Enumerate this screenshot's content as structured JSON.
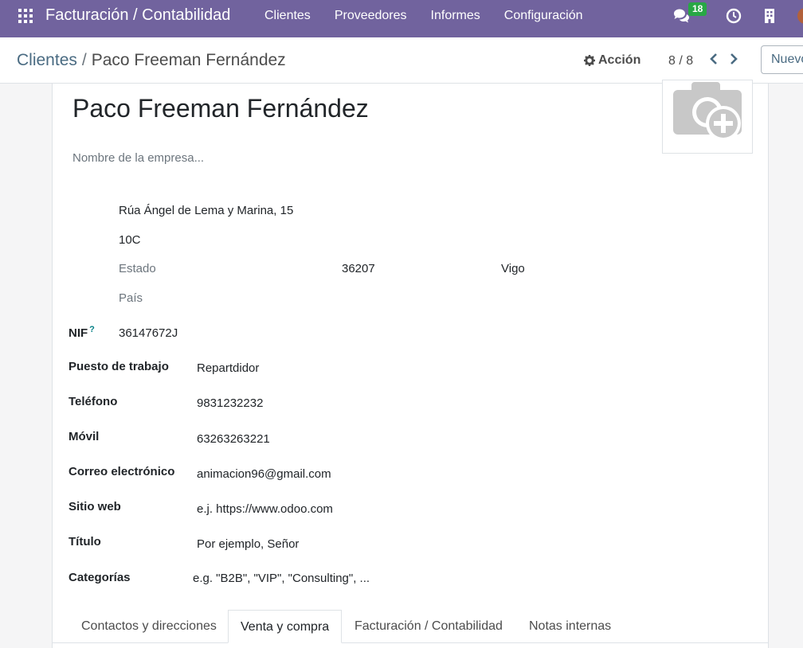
{
  "navbar": {
    "app_title": "Facturación / Contabilidad",
    "menu": [
      "Clientes",
      "Proveedores",
      "Informes",
      "Configuración"
    ],
    "messages_count": "18",
    "bg_color": "#71639e"
  },
  "control_panel": {
    "breadcrumb_parent": "Clientes",
    "breadcrumb_separator": "/",
    "breadcrumb_current": "Paco Freeman Fernández",
    "action_label": "Acción",
    "pager": "8 / 8",
    "new_label": "Nuevo"
  },
  "form": {
    "name": "Paco Freeman Fernández",
    "company_placeholder": "Nombre de la empresa...",
    "address": {
      "street": "Rúa Ángel de Lema y Marina, 15",
      "street2": "10C",
      "state_placeholder": "Estado",
      "zip": "36207",
      "city": "Vigo",
      "country_placeholder": "País"
    },
    "fields": {
      "nif": {
        "label": "NIF",
        "help": "?",
        "value": "36147672J"
      },
      "job": {
        "label": "Puesto de trabajo",
        "value": "Repartdidor"
      },
      "phone": {
        "label": "Teléfono",
        "value": "9831232232"
      },
      "mobile": {
        "label": "Móvil",
        "value": "63263263221"
      },
      "email": {
        "label": "Correo electrónico",
        "value": "animacion96@gmail.com"
      },
      "website": {
        "label": "Sitio web",
        "placeholder": "e.j. https://www.odoo.com"
      },
      "title": {
        "label": "Título",
        "placeholder": "Por ejemplo, Señor"
      },
      "categories": {
        "label": "Categorías",
        "placeholder": "e.g. \"B2B\", \"VIP\", \"Consulting\", ..."
      }
    }
  },
  "tabs": [
    "Contactos y direcciones",
    "Venta y compra",
    "Facturación / Contabilidad",
    "Notas internas"
  ],
  "active_tab": "Venta y compra"
}
